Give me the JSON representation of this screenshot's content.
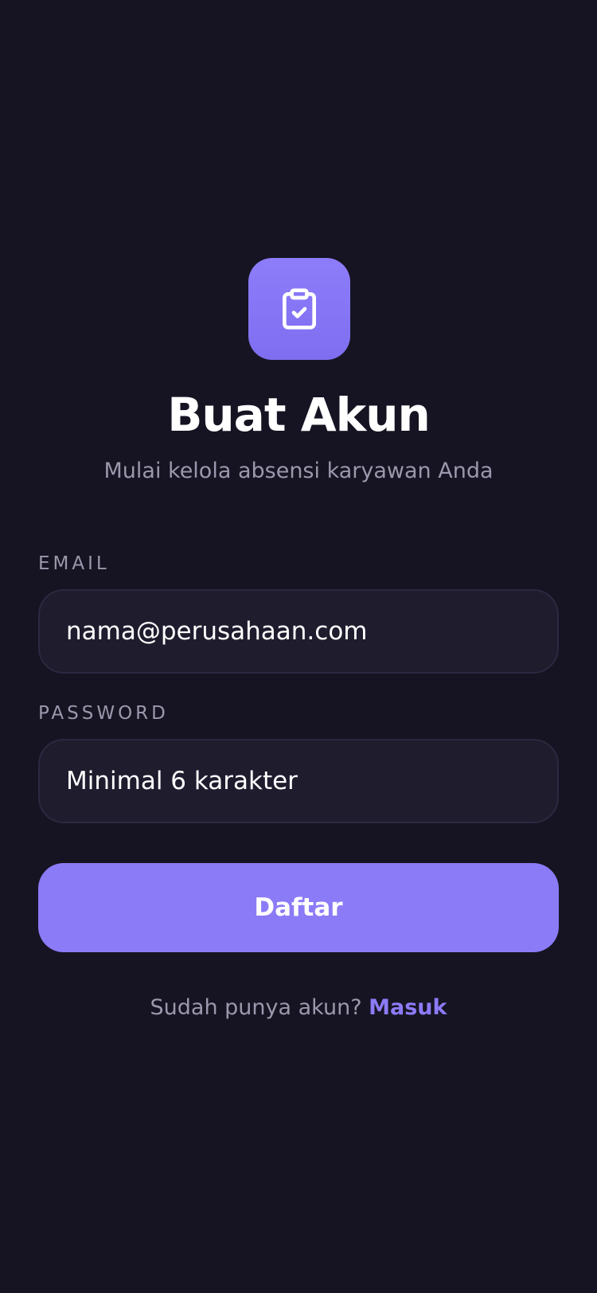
{
  "header": {
    "logo_icon": "clipboard-check-icon",
    "title": "Buat Akun",
    "subtitle": "Mulai kelola absensi karyawan Anda"
  },
  "form": {
    "email": {
      "label": "EMAIL",
      "placeholder": "nama@perusahaan.com",
      "value": ""
    },
    "password": {
      "label": "PASSWORD",
      "placeholder": "Minimal 6 karakter",
      "value": ""
    },
    "submit_label": "Daftar"
  },
  "footer": {
    "prompt": "Sudah punya akun?",
    "link_label": "Masuk"
  },
  "colors": {
    "background": "#161422",
    "accent": "#8b7bf7",
    "field_background": "#1f1c2e",
    "muted_text": "#9b98ad"
  }
}
